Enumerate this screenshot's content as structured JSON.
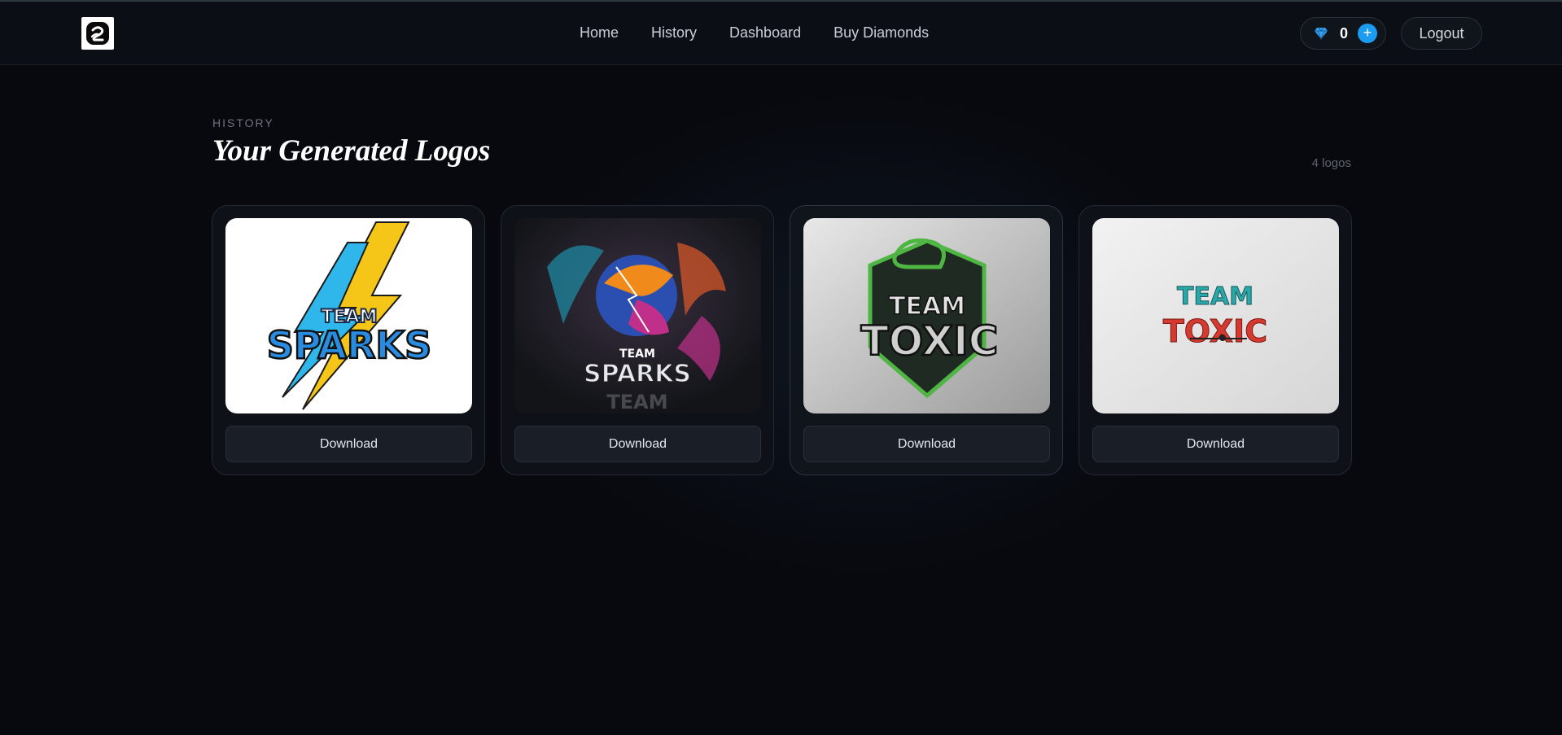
{
  "nav": {
    "links": [
      "Home",
      "History",
      "Dashboard",
      "Buy Diamonds"
    ],
    "diamond_count": "0",
    "add_symbol": "+",
    "logout_label": "Logout"
  },
  "header": {
    "eyebrow": "HISTORY",
    "title": "Your Generated Logos",
    "count_label": "4 logos"
  },
  "logos": [
    {
      "line1": "TEAM",
      "line2": "SPARKS",
      "download_label": "Download"
    },
    {
      "line1": "TEAM",
      "line2": "SPARKS",
      "line3": "TEAM",
      "download_label": "Download"
    },
    {
      "line1": "TEAM",
      "line2": "TOXIC",
      "download_label": "Download"
    },
    {
      "line1": "TEAM",
      "line2": "TOXIC",
      "download_label": "Download"
    }
  ],
  "colors": {
    "background": "#07090e",
    "accent_blue": "#1b9cf0",
    "diamond": "#3aa0f0"
  },
  "icons": [
    "app-logo-icon",
    "diamond-icon",
    "plus-icon"
  ]
}
